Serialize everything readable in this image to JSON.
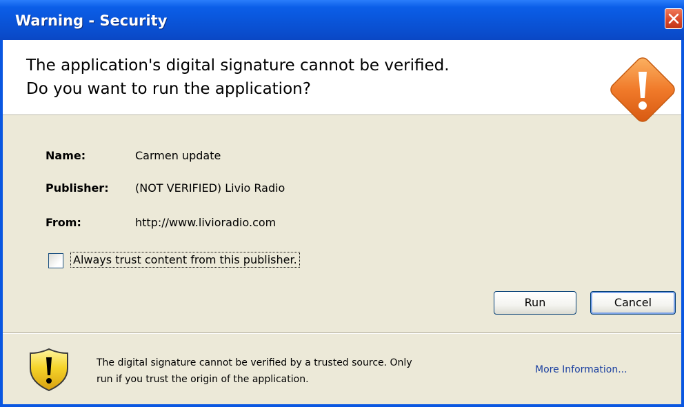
{
  "window": {
    "title": "Warning - Security"
  },
  "header": {
    "line1": "The application's digital signature cannot be verified.",
    "line2": "Do you want to run the application?",
    "icon": "warning-diamond-icon"
  },
  "details": {
    "name_label": "Name:",
    "name_value": "Carmen update",
    "publisher_label": "Publisher:",
    "publisher_value": "(NOT VERIFIED) Livio Radio",
    "from_label": "From:",
    "from_value": "http://www.livioradio.com"
  },
  "trust": {
    "checked": false,
    "label": "Always trust content from this publisher."
  },
  "buttons": {
    "run": "Run",
    "cancel": "Cancel"
  },
  "footer": {
    "line1": "The digital signature cannot be verified by a trusted source.  Only",
    "line2": "run if you trust the origin of the application.",
    "more_info": "More Information...",
    "icon": "security-shield-icon"
  },
  "colors": {
    "title_bar": "#0a54d8",
    "close_button": "#d9482a",
    "dialog_bg": "#ece9d8",
    "warning_orange": "#f07a2a",
    "shield_yellow": "#f5d42a",
    "link": "#1a3fa0"
  }
}
